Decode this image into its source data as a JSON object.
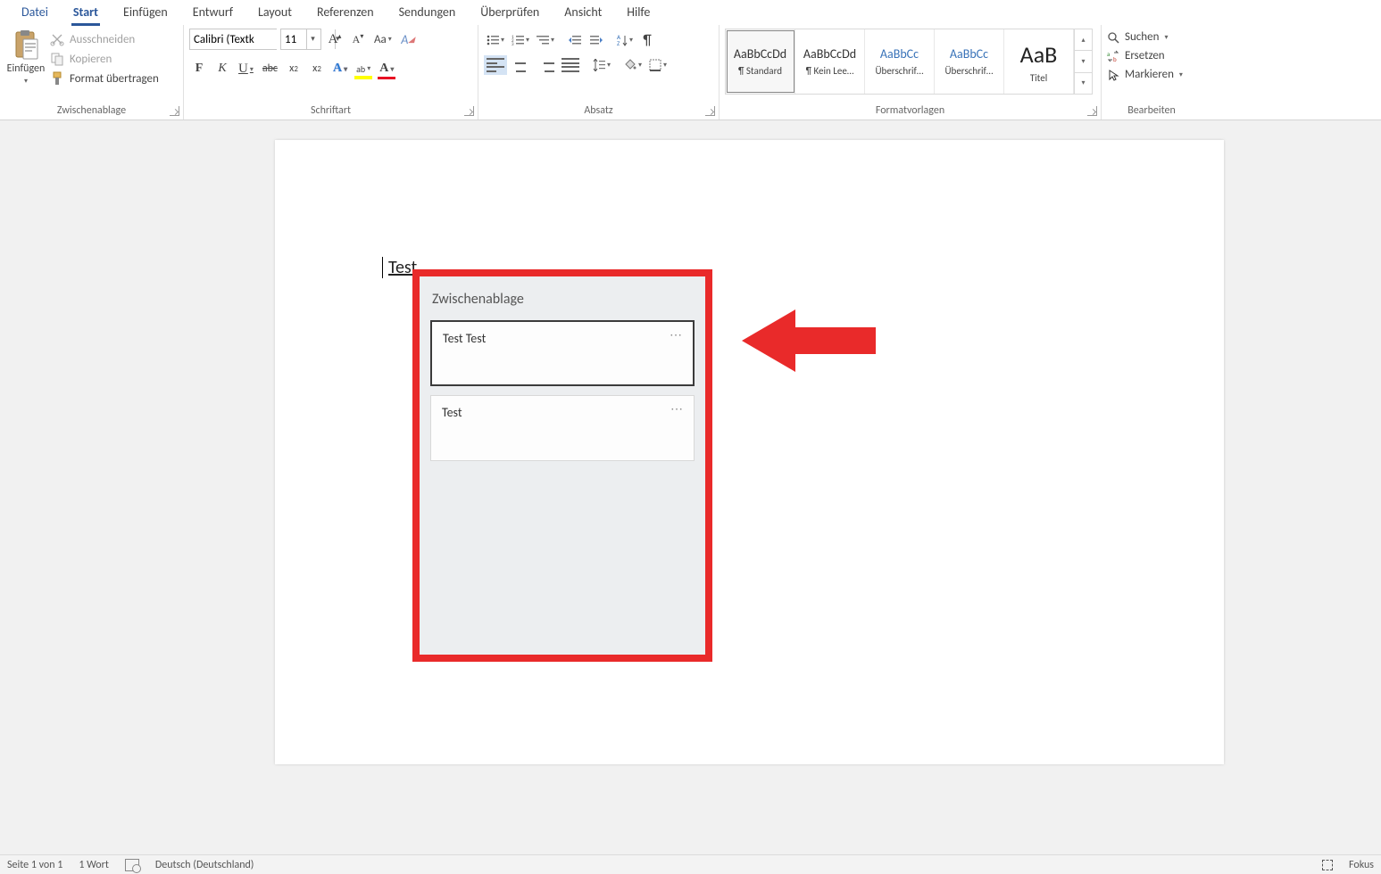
{
  "tabs": {
    "datei": "Datei",
    "start": "Start",
    "einfuegen": "Einfügen",
    "entwurf": "Entwurf",
    "layout": "Layout",
    "referenzen": "Referenzen",
    "sendungen": "Sendungen",
    "ueberpruefen": "Überprüfen",
    "ansicht": "Ansicht",
    "hilfe": "Hilfe"
  },
  "clipboard": {
    "group_label": "Zwischenablage",
    "paste": "Einfügen",
    "cut": "Ausschneiden",
    "copy": "Kopieren",
    "format_painter": "Format übertragen"
  },
  "font": {
    "group_label": "Schriftart",
    "name": "Calibri (Textkörper)",
    "name_display": "Calibri (Textk",
    "size": "11"
  },
  "paragraph": {
    "group_label": "Absatz"
  },
  "styles": {
    "group_label": "Formatvorlagen",
    "items": [
      {
        "preview": "AaBbCcDd",
        "name": "¶ Standard",
        "cls": "",
        "sel": true
      },
      {
        "preview": "AaBbCcDd",
        "name": "¶ Kein Lee…",
        "cls": ""
      },
      {
        "preview": "AaBbCc",
        "name": "Überschrif…",
        "cls": "blue"
      },
      {
        "preview": "AaBbCc",
        "name": "Überschrif…",
        "cls": "blue"
      },
      {
        "preview": "AaB",
        "name": "Titel",
        "cls": "big"
      }
    ]
  },
  "editing": {
    "group_label": "Bearbeiten",
    "find": "Suchen",
    "replace": "Ersetzen",
    "select": "Markieren"
  },
  "document": {
    "text": "Test"
  },
  "popup": {
    "title": "Zwischenablage",
    "items": [
      {
        "text": "Test Test",
        "selected": true
      },
      {
        "text": "Test",
        "selected": false
      }
    ]
  },
  "status": {
    "page": "Seite 1 von 1",
    "words": "1 Wort",
    "lang": "Deutsch (Deutschland)",
    "fokus": "Fokus"
  }
}
